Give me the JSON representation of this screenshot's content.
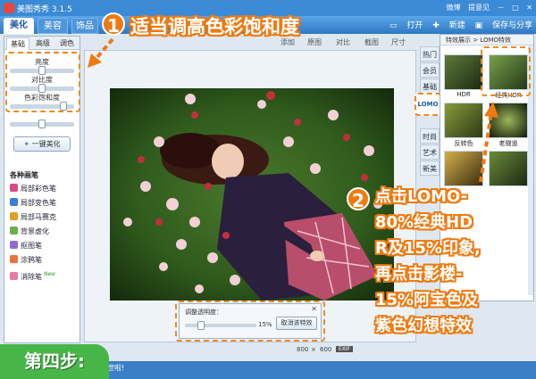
{
  "window": {
    "title": "美图秀秀 3.1.5",
    "right_items": [
      "微博",
      "提意见"
    ]
  },
  "main_tabs": [
    {
      "label": "美化"
    },
    {
      "label": "美容"
    },
    {
      "label": "饰品"
    }
  ],
  "tab_tools": [
    "打开",
    "新建",
    "保存与分享"
  ],
  "left_panel": {
    "subtabs": [
      "基础",
      "高级",
      "调色"
    ],
    "sliders": [
      {
        "label": "亮度",
        "value": 0.5
      },
      {
        "label": "对比度",
        "value": 0.5
      },
      {
        "label": "色彩饱和度",
        "value": 0.8
      }
    ],
    "one_click": "一键美化",
    "brush_title": "各种画笔",
    "brushes": [
      {
        "label": "局部彩色笔",
        "color": "#d94a8c"
      },
      {
        "label": "局部变色笔",
        "color": "#3a7fd6"
      },
      {
        "label": "局部马赛克",
        "color": "#e0a020"
      },
      {
        "label": "背景虚化",
        "color": "#6ab04c"
      },
      {
        "label": "抠图笔",
        "color": "#8e6ccf"
      },
      {
        "label": "涂鸦笔",
        "color": "#e8743b"
      },
      {
        "label": "消除笔",
        "color": "#e77aa6",
        "badge": "New"
      }
    ]
  },
  "canvas_toolbar": [
    "添加",
    "原图",
    "对比",
    "截图",
    "尺寸"
  ],
  "right_panel": {
    "header": "特效展示 > LOMO特效",
    "tabs": [
      "热门",
      "LOMO",
      "时尚",
      "艺术",
      "新美"
    ],
    "tabs_partial": [
      "会员",
      "基础"
    ],
    "thumbs": [
      {
        "label": "HDR"
      },
      {
        "label": "经典HDR"
      },
      {
        "label": "反转色"
      },
      {
        "label": "老隧道"
      },
      {
        "label": ""
      },
      {
        "label": ""
      }
    ]
  },
  "opacity": {
    "title": "调整透明度：",
    "value": "15%",
    "value_fraction": 0.15,
    "cancel": "取消该特效"
  },
  "status": {
    "size_w": "800",
    "size_x": "×",
    "size_h": "600",
    "badge": "EXIF"
  },
  "bottom_tip": "视世啦!",
  "annotations": {
    "step1_num": "1",
    "step1_text": "适当调高色彩饱和度",
    "step2_num": "2",
    "step2_lines": [
      "点击LOMO-",
      "80%经典HD",
      "R及15%印象,",
      "再点击影楼-",
      "15%阿宝色及",
      "紫色幻想特效"
    ],
    "step_label": "第四步:"
  },
  "colors": {
    "accent": "#ef7a10",
    "title_bar": "#3a8ad6",
    "step_green": "#48b548"
  }
}
